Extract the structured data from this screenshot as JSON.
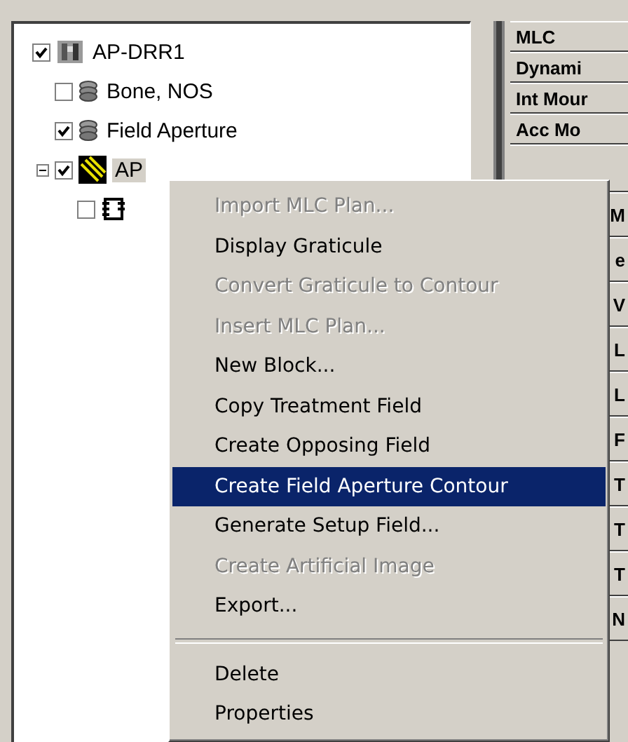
{
  "tree": [
    {
      "label": "AP-DRR1",
      "checked": true,
      "selected": false,
      "kind": "image",
      "children": [
        {
          "label": "Bone, NOS",
          "checked": false,
          "selected": false,
          "kind": "layers"
        },
        {
          "label": "Field Aperture",
          "checked": true,
          "selected": false,
          "kind": "layers"
        },
        {
          "label": "AP",
          "checked": true,
          "expanded": true,
          "selected": true,
          "kind": "beam",
          "children": [
            {
              "checked": false,
              "kind": "block"
            }
          ]
        }
      ]
    }
  ],
  "properties": [
    {
      "label": "MLC",
      "kind": "full"
    },
    {
      "label": "Dynami",
      "kind": "full"
    },
    {
      "label": "Int Mour",
      "kind": "full"
    },
    {
      "label": "Acc Mo",
      "kind": "full"
    },
    {
      "kind": "hidden"
    },
    {
      "label": "M",
      "kind": "clipped"
    },
    {
      "label": "e",
      "kind": "clipped"
    },
    {
      "label": "V",
      "kind": "clipped"
    },
    {
      "label": "L",
      "kind": "clipped"
    },
    {
      "label": "L",
      "kind": "clipped"
    },
    {
      "label": "F",
      "kind": "clipped"
    },
    {
      "label": "T",
      "kind": "clipped"
    },
    {
      "label": "T",
      "kind": "clipped"
    },
    {
      "label": "T",
      "kind": "clipped"
    },
    {
      "label": "N",
      "kind": "clipped"
    }
  ],
  "context_menu": [
    {
      "kind": "item",
      "label": "Import MLC Plan...",
      "disabled": true,
      "selected": false
    },
    {
      "kind": "item",
      "label": "Display Graticule",
      "disabled": false,
      "selected": false
    },
    {
      "kind": "item",
      "label": "Convert Graticule to Contour",
      "disabled": true,
      "selected": false
    },
    {
      "kind": "item",
      "label": "Insert MLC Plan...",
      "disabled": true,
      "selected": false
    },
    {
      "kind": "item",
      "label": "New Block...",
      "disabled": false,
      "selected": false
    },
    {
      "kind": "item",
      "label": "Copy Treatment Field",
      "disabled": false,
      "selected": false
    },
    {
      "kind": "item",
      "label": "Create Opposing Field",
      "disabled": false,
      "selected": false
    },
    {
      "kind": "item",
      "label": "Create Field Aperture Contour",
      "disabled": false,
      "selected": true
    },
    {
      "kind": "item",
      "label": "Generate Setup Field...",
      "disabled": false,
      "selected": false
    },
    {
      "kind": "item",
      "label": "Create Artificial Image",
      "disabled": true,
      "selected": false
    },
    {
      "kind": "item",
      "label": "Export...",
      "disabled": false,
      "selected": false
    },
    {
      "kind": "separator"
    },
    {
      "kind": "item",
      "label": "Delete",
      "disabled": false,
      "selected": false
    },
    {
      "kind": "item",
      "label": "Properties",
      "disabled": false,
      "selected": false
    }
  ]
}
